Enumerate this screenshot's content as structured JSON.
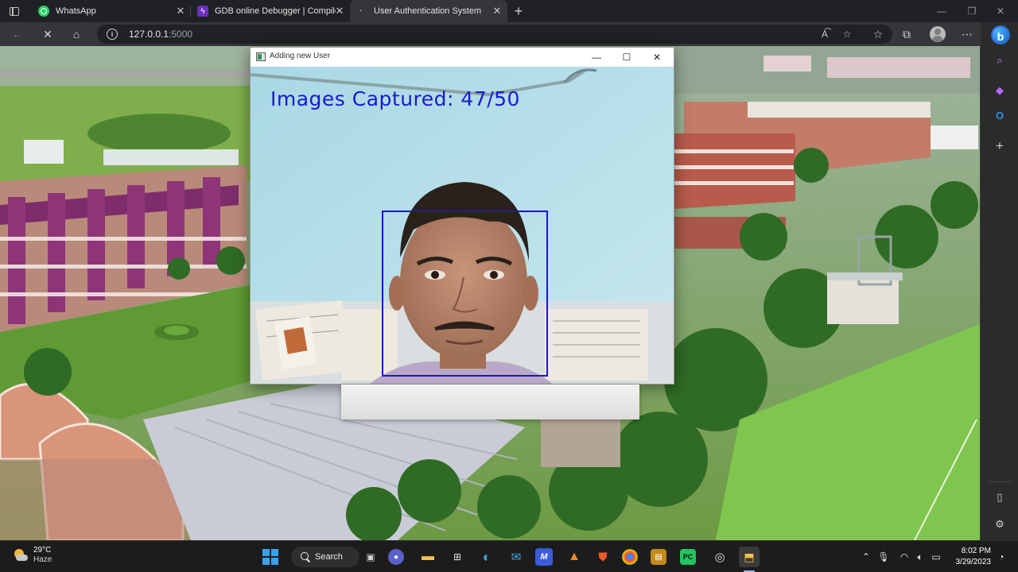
{
  "browser": {
    "tabs": [
      {
        "title": "WhatsApp",
        "favicon": "whatsapp-icon",
        "active": false
      },
      {
        "title": "GDB online Debugger | Compiler",
        "favicon": "gdb-icon",
        "active": false
      },
      {
        "title": "User Authentication System",
        "favicon": "loading-icon",
        "active": true
      }
    ],
    "address": {
      "host": "127.0.0.1",
      "port": ":5000"
    },
    "info_glyph": "i"
  },
  "cv_window": {
    "title": "Adding new User",
    "overlay_text": "Images Captured: 47/50",
    "captured": 47,
    "total": 50,
    "overlay_color": "#1a1ad0",
    "face_box_color": "#1c14c8"
  },
  "taskbar": {
    "weather": {
      "temperature": "29°C",
      "condition": "Haze"
    },
    "search_label": "Search",
    "time": "8:02 PM",
    "date": "3/29/2023"
  },
  "colors": {
    "browser_bg": "#202124",
    "toolbar_bg": "#35363a",
    "taskbar_bg": "#1c1c1c",
    "accent": "#8ab4f8"
  }
}
